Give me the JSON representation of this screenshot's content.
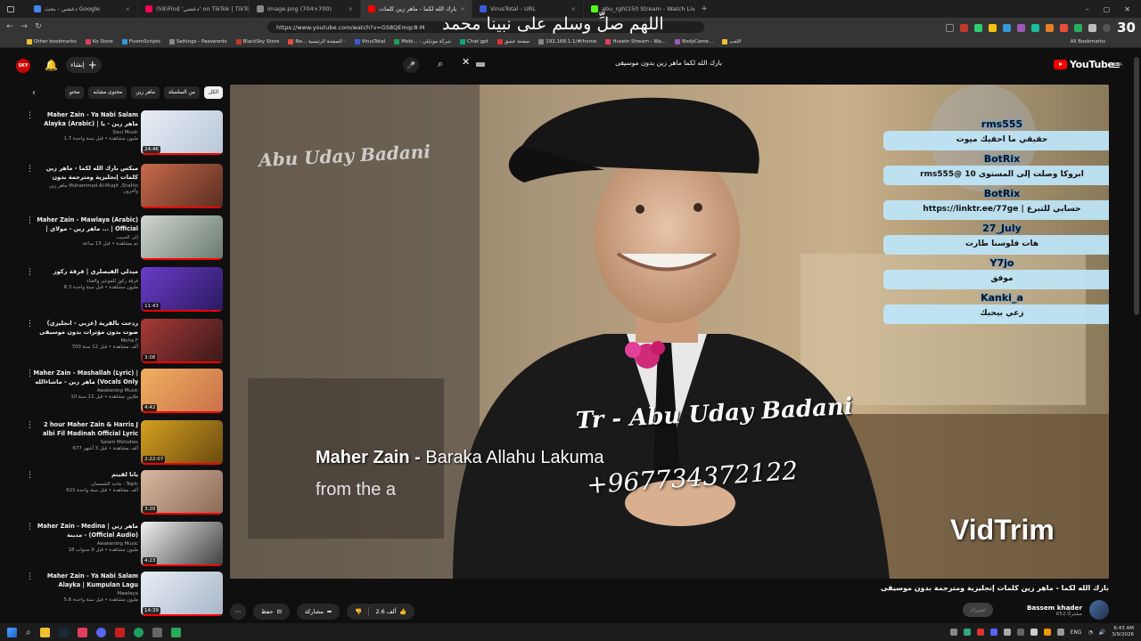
{
  "browser": {
    "tabs": [
      {
        "label": "دعشي - بحث Google",
        "color": "#4285f4"
      },
      {
        "label": "(59)Find 'دعشي' on TikTok | TikTok Se",
        "color": "#ff0050"
      },
      {
        "label": "image.png (704×700)",
        "color": "#888888"
      },
      {
        "label": "بارك الله لكما - ماهر زين كلمات",
        "color": "#ff0000"
      },
      {
        "label": "VirusTotal - URL",
        "color": "#3b5bdb"
      },
      {
        "label": "abu_rght150 Stream - Watch Live on",
        "color": "#53fc18"
      }
    ],
    "new_tab": "+",
    "url": "https://www.youtube.com/watch?v=GS8QEmqc8-M",
    "overlay_text": "اللهم صلِّ وسلم على نبينا محمد",
    "ext_badge": "30",
    "bookmarks": [
      "Other bookmarks",
      "Ko Store",
      "FivemScripts",
      "Settings - Passwords",
      "BlackSky Store",
      "Ne... الصفحة الرئيسية -",
      "VirusTotal",
      "Mobi... - شركة موبايلي",
      "Chat gpt",
      "صفحة عشق",
      "192.168.1.1/#/home",
      "Husein Stream - Wa...",
      "BodyCame...",
      "اللعب"
    ],
    "all_bookmarks": "All Bookmarks"
  },
  "youtube": {
    "account_initials": "SKY",
    "create_label": "إنشاء",
    "search_query": "بارك الله لكما ماهر زين بدون موسيقى",
    "logo_text": "YouTube",
    "logo_region": "SA",
    "chips": [
      "الكل",
      "من السلسلة",
      "ماهر زين",
      "محتوى مشابه",
      "محتو"
    ],
    "playlist": [
      {
        "title": "Maher Zain - Ya Nabi Salam Alayka (Arabic) | ماهر زين - يا نبي",
        "channel": "Soul Music",
        "stats": "1.7 مليون مشاهدة • قبل سنة واحدة",
        "duration": "24:46",
        "colors": [
          "#e8eef5",
          "#b8c6d8"
        ]
      },
      {
        "title": "ميكس بارك الله لكما - ماهر زين كلمات إنجليزية ومترجمة بدون موسيقى",
        "channel": "ماهر زين Muhammad Al-Muqit ،Shahin وآخرون",
        "stats": "",
        "duration": "",
        "colors": [
          "#c86a4a",
          "#5a2e22"
        ]
      },
      {
        "title": "Maher Zain - Mawlaya (Arabic) | ماهر زين - مولاي ... | Official Lyric",
        "channel": "إلى الحبيب",
        "stats": "تم مشاهدة • قبل 15 ساعة",
        "duration": "",
        "colors": [
          "#cfd6cf",
          "#6a7a70"
        ]
      },
      {
        "title": "ميدلي الفيصلري | فرقة ركوز",
        "channel": "فرقة ركوز للمونتير والغناء",
        "stats": "8.3 مليون مشاهدة • قبل سنة واحدة",
        "duration": "11:43",
        "colors": [
          "#6a3cc8",
          "#2a1a60"
        ]
      },
      {
        "title": "ردحت بالقرية (عربي - انجليزي) صوت بدون مؤثرات بدون موسيقى",
        "channel": "Moha F",
        "stats": "700 ألف مشاهدة • قبل 12 سنة",
        "duration": "3:08",
        "colors": [
          "#a83a3a",
          "#3a1818"
        ]
      },
      {
        "title": "Maher Zain - Mashallah (Lyric) | ماهر زين - ماشاءالله (Vocals Only -",
        "channel": "Awakening Music",
        "stats": "10 ملايين مشاهدة • قبل 12 سنة",
        "duration": "4:42",
        "colors": [
          "#f0b060",
          "#c8704a"
        ]
      },
      {
        "title": "2 hour Maher Zain & Harris J albi Fil Madinah Official Lyric",
        "channel": "Salam Melodies",
        "stats": "677 ألف مشاهدة • قبل 3 أشهر",
        "duration": "2:22:07",
        "colors": [
          "#d4a020",
          "#6a4a10"
        ]
      },
      {
        "title": "يانا لقيتم",
        "channel": "ماجد الشمسان - Topic",
        "stats": "621 ألف مشاهدة • قبل سنة واحدة",
        "duration": "3:20",
        "colors": [
          "#d8b8a0",
          "#8a6a58"
        ]
      },
      {
        "title": "Maher Zain - Medina | ماهر زين - مدينة (Official Audio)",
        "channel": "Awakening Music",
        "stats": "18 مليون مشاهدة • قبل 9 سنوات",
        "duration": "4:23",
        "colors": [
          "#f0f0f0",
          "#404040"
        ]
      },
      {
        "title": "Maher Zain - Ya Nabi Salam Alayka | Kumpulan Lagu Terbaik",
        "channel": "Mawlaya",
        "stats": "5.6 مليون مشاهدة • قبل سنة واحدة",
        "duration": "14:39",
        "colors": [
          "#e8eef5",
          "#a8b6c8"
        ]
      }
    ],
    "video": {
      "top_watermark": "Abu Uday Badani",
      "translator": "Tr - Abu Uday Badani",
      "song_artist": "Maher Zain -",
      "song_title": "Baraka Allahu Lakuma",
      "subtitle": "from the a",
      "phone": "+967734372122",
      "brand": "VidTrim",
      "chat": [
        {
          "user": "rms555",
          "text": "حقيقي ما احقيك ميوت"
        },
        {
          "user": "BotRix",
          "text": "ابروكا وصلت إلى المستوى 10 @rms555"
        },
        {
          "user": "BotRix",
          "text": "حسابي للتبرع | https://linktr.ee/77ge"
        },
        {
          "user": "27_July",
          "text": "هات فلوسنا طارت"
        },
        {
          "user": "Y7jo",
          "text": "موفق"
        },
        {
          "user": "Kanki_a",
          "text": "زعي بيحبك"
        }
      ]
    },
    "video_title": "بارك الله لكما - ماهر زين كلمات إنجليزية ومترجمة بدون موسيقى",
    "likes": "2.6 ألف",
    "share_label": "مشاركة",
    "save_label": "حفظ",
    "channel_name": "Bassem khader",
    "channel_subs": "652 مشتركًا",
    "subscribe_label": "اشتراك"
  },
  "taskbar": {
    "language": "ENG",
    "time": "6:43 AM",
    "date": "3/9/2026"
  }
}
